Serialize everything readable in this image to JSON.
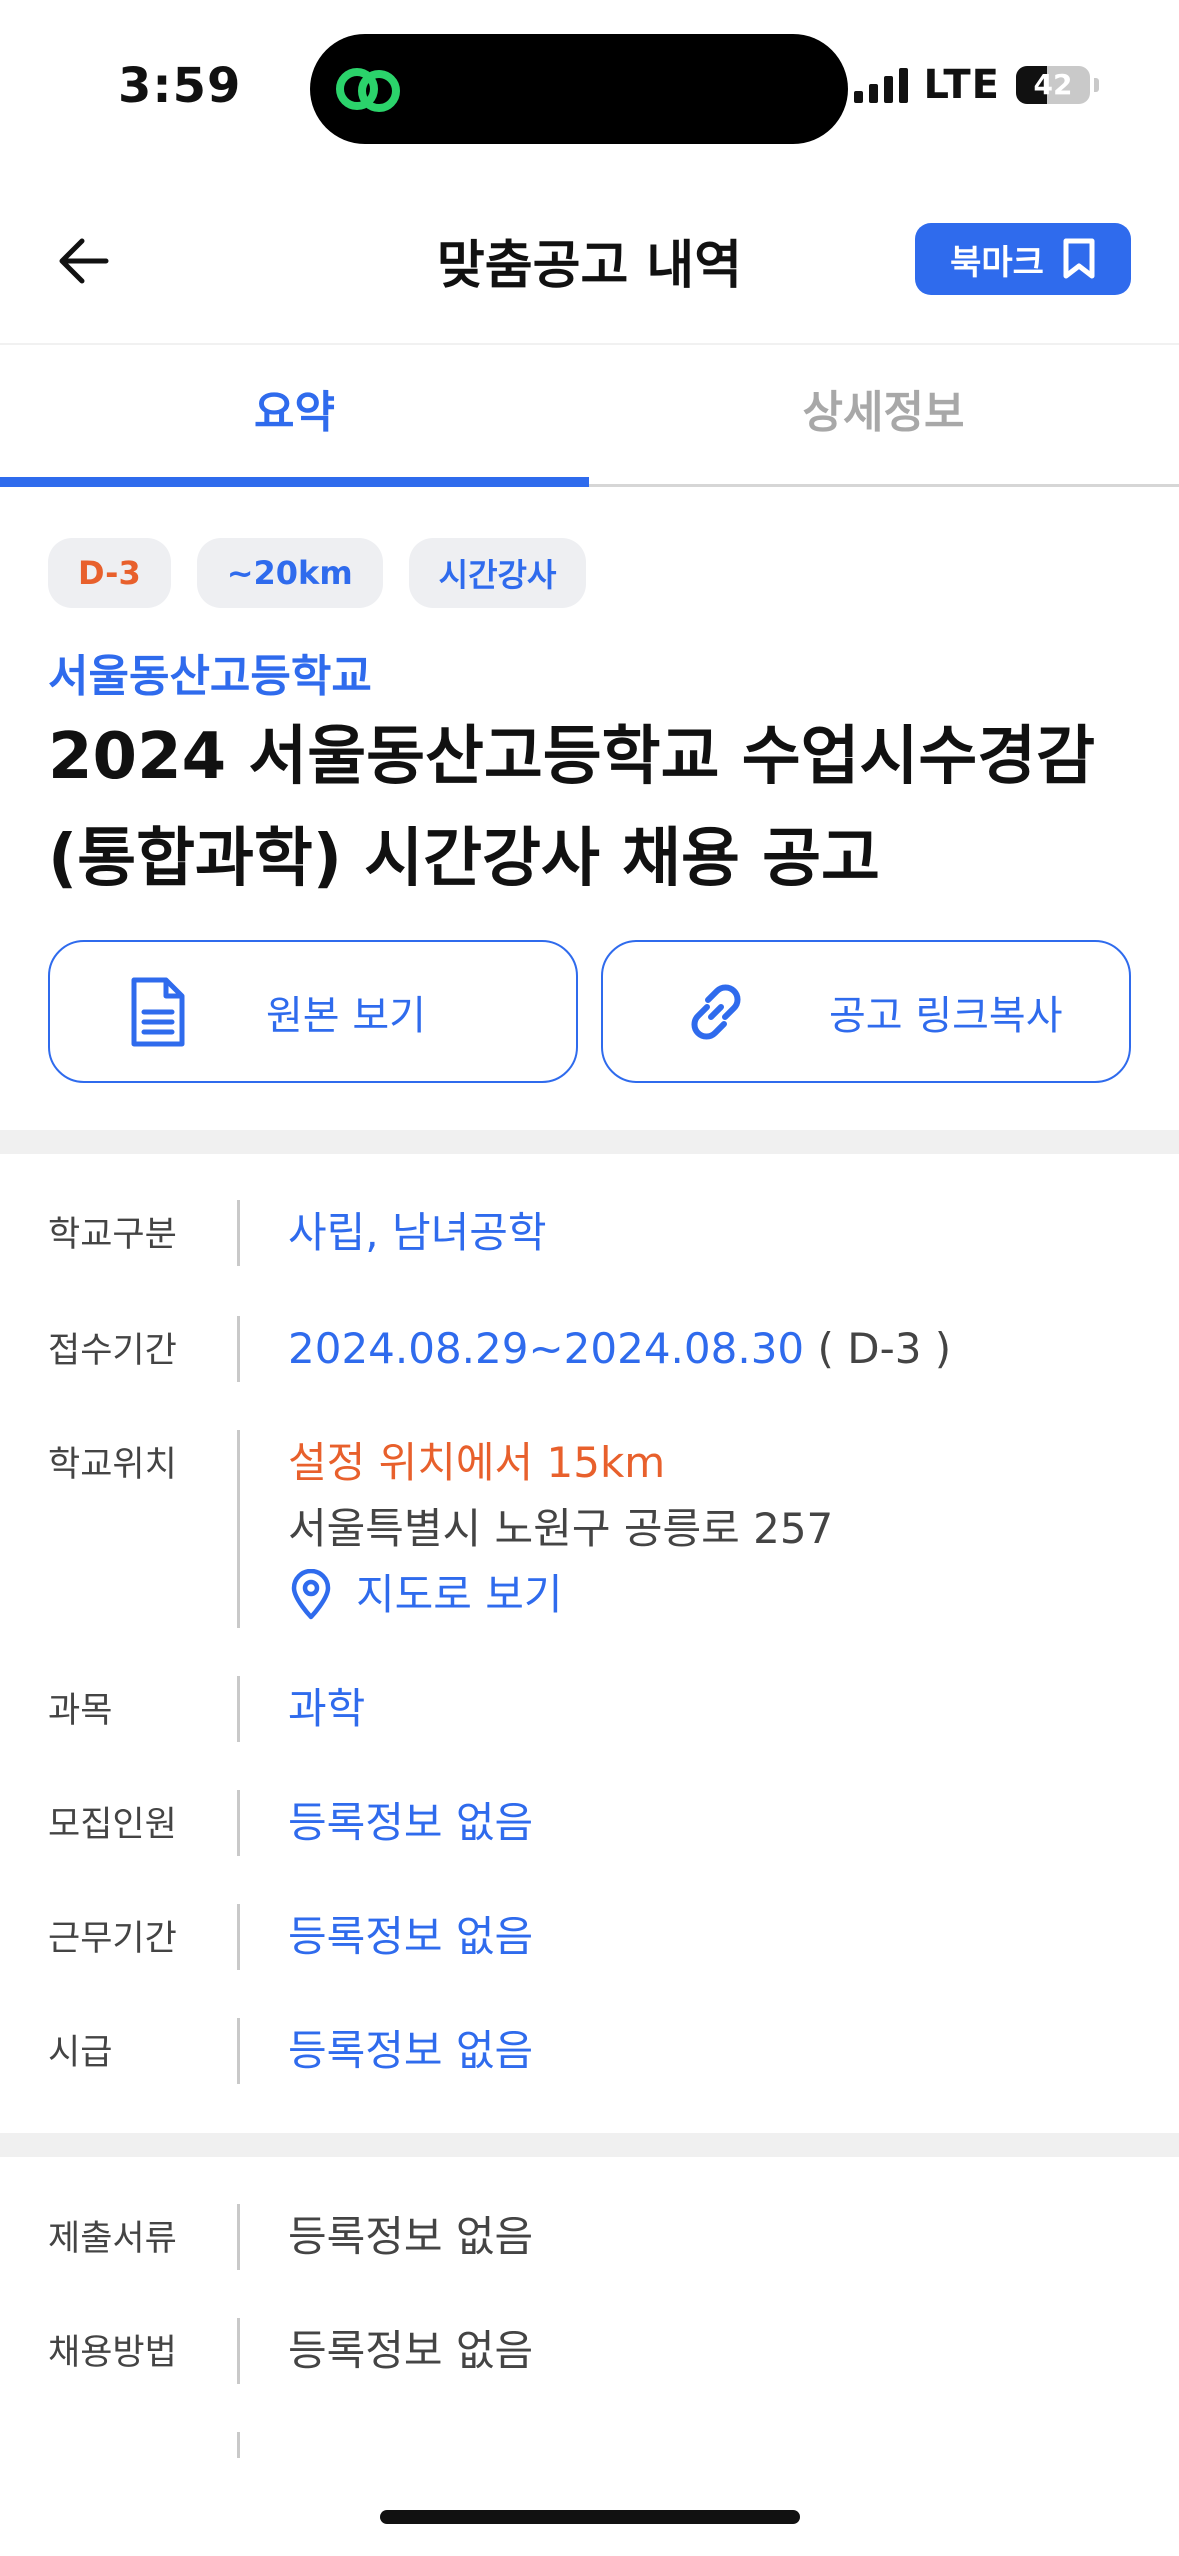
{
  "status_bar": {
    "time": "3:59",
    "network": "LTE",
    "battery": "42",
    "battery_level": 0.42
  },
  "nav": {
    "title": "맞춤공고 내역",
    "bookmark_label": "북마크"
  },
  "tabs": [
    {
      "label": "요약",
      "active": true
    },
    {
      "label": "상세정보",
      "active": false
    }
  ],
  "chips": {
    "deadline": "D-3",
    "distance": "~20km",
    "type": "시간강사"
  },
  "school_name": "서울동산고등학교",
  "job_title": "2024 서울동산고등학교 수업시수경감 (통합과학) 시간강사 채용 공고",
  "actions": {
    "view_original": "원본 보기",
    "copy_link": "공고 링크복사"
  },
  "info_section_1": {
    "school_type": {
      "label": "학교구분",
      "value": "사립, 남녀공학"
    },
    "period": {
      "label": "접수기간",
      "value": "2024.08.29~2024.08.30",
      "dday": "( D-3 )"
    },
    "location": {
      "label": "학교위치",
      "distance": "설정 위치에서 15km",
      "address": "서울특별시 노원구 공릉로 257",
      "map_link": "지도로 보기"
    },
    "subject": {
      "label": "과목",
      "value": "과학"
    },
    "recruits": {
      "label": "모집인원",
      "value": "등록정보 없음"
    },
    "work_period": {
      "label": "근무기간",
      "value": "등록정보 없음"
    },
    "hourly_wage": {
      "label": "시급",
      "value": "등록정보 없음"
    }
  },
  "info_section_2": {
    "documents": {
      "label": "제출서류",
      "value": "등록정보 없음"
    },
    "method": {
      "label": "채용방법",
      "value": "등록정보 없음"
    }
  },
  "colors": {
    "accent": "#2f6bed",
    "warning": "#e8602c",
    "muted": "#a8a8a8"
  }
}
